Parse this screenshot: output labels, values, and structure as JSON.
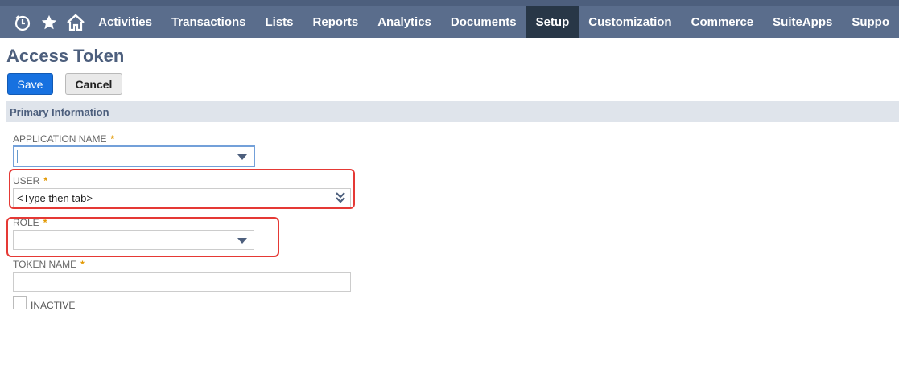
{
  "nav": {
    "icons": [
      "recent-records-icon",
      "favorites-star-icon",
      "home-icon"
    ],
    "items": [
      {
        "label": "Activities"
      },
      {
        "label": "Transactions"
      },
      {
        "label": "Lists"
      },
      {
        "label": "Reports"
      },
      {
        "label": "Analytics"
      },
      {
        "label": "Documents"
      },
      {
        "label": "Setup",
        "active": true
      },
      {
        "label": "Customization"
      },
      {
        "label": "Commerce"
      },
      {
        "label": "SuiteApps"
      },
      {
        "label": "Suppo"
      }
    ]
  },
  "page": {
    "title": "Access Token"
  },
  "toolbar": {
    "save_label": "Save",
    "cancel_label": "Cancel"
  },
  "section": {
    "title": "Primary Information"
  },
  "fields": {
    "application_name": {
      "label": "APPLICATION NAME",
      "required": "*",
      "value": ""
    },
    "user": {
      "label": "USER",
      "required": "*",
      "value": "<Type then tab>"
    },
    "role": {
      "label": "ROLE",
      "required": "*",
      "value": ""
    },
    "token_name": {
      "label": "TOKEN NAME",
      "required": "*",
      "value": ""
    },
    "inactive": {
      "label": "INACTIVE",
      "checked": false
    }
  },
  "colors": {
    "nav_bg": "#5a6d8c",
    "nav_active": "#283747",
    "primary_button": "#1771e0",
    "required_star": "#e29800",
    "highlight": "#e53935"
  }
}
